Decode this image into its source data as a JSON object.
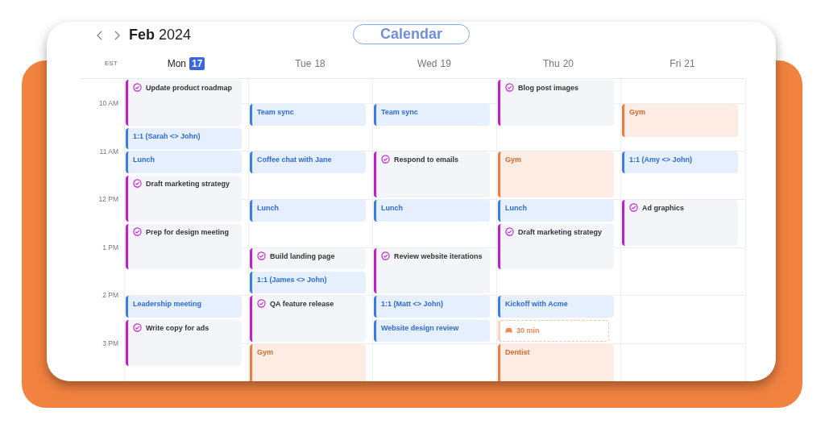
{
  "header": {
    "month": "Feb",
    "year": "2024",
    "badge": "Calendar"
  },
  "timezone": "EST",
  "days": [
    {
      "weekday": "Mon",
      "date": "17",
      "selected": true,
      "events": [
        {
          "title": "Update product roadmap",
          "kind": "task"
        },
        {
          "title": "1:1 (Sarah <> John)",
          "kind": "meeting"
        },
        {
          "title": "Lunch",
          "kind": "meeting"
        },
        {
          "title": "Draft marketing strategy",
          "kind": "task"
        },
        {
          "title": "Prep for design meeting",
          "kind": "task"
        },
        {
          "title": "Leadership meeting",
          "kind": "meeting"
        },
        {
          "title": "Write copy for ads",
          "kind": "task"
        }
      ]
    },
    {
      "weekday": "Tue",
      "date": "18",
      "selected": false,
      "events": [
        {
          "title": "Team sync",
          "kind": "meeting"
        },
        {
          "title": "Coffee chat with Jane",
          "kind": "meeting"
        },
        {
          "title": "Lunch",
          "kind": "meeting"
        },
        {
          "title": "Build landing page",
          "kind": "task"
        },
        {
          "title": "1:1 (James <> John)",
          "kind": "meeting"
        },
        {
          "title": "QA feature release",
          "kind": "task"
        },
        {
          "title": "Gym",
          "kind": "personal"
        }
      ]
    },
    {
      "weekday": "Wed",
      "date": "19",
      "selected": false,
      "events": [
        {
          "title": "Team sync",
          "kind": "meeting"
        },
        {
          "title": "Respond to emails",
          "kind": "task"
        },
        {
          "title": "Lunch",
          "kind": "meeting"
        },
        {
          "title": "Review website iterations",
          "kind": "task"
        },
        {
          "title": "1:1 (Matt <> John)",
          "kind": "meeting"
        },
        {
          "title": "Website design review",
          "kind": "meeting"
        }
      ]
    },
    {
      "weekday": "Thu",
      "date": "20",
      "selected": false,
      "events": [
        {
          "title": "Blog post images",
          "kind": "task"
        },
        {
          "title": "Gym",
          "kind": "personal"
        },
        {
          "title": "Lunch",
          "kind": "meeting"
        },
        {
          "title": "Draft marketing strategy",
          "kind": "task"
        },
        {
          "title": "Kickoff with Acme",
          "kind": "meeting"
        },
        {
          "title": "30 min",
          "kind": "travel"
        },
        {
          "title": "Dentist",
          "kind": "personal"
        }
      ]
    },
    {
      "weekday": "Fri",
      "date": "21",
      "selected": false,
      "events": [
        {
          "title": "Gym",
          "kind": "personal"
        },
        {
          "title": "1:1 (Amy <> John)",
          "kind": "meeting"
        },
        {
          "title": "Ad graphics",
          "kind": "task"
        }
      ]
    }
  ],
  "hours": [
    "10 AM",
    "11 AM",
    "12 PM",
    "1 PM",
    "2 PM",
    "3 PM"
  ]
}
